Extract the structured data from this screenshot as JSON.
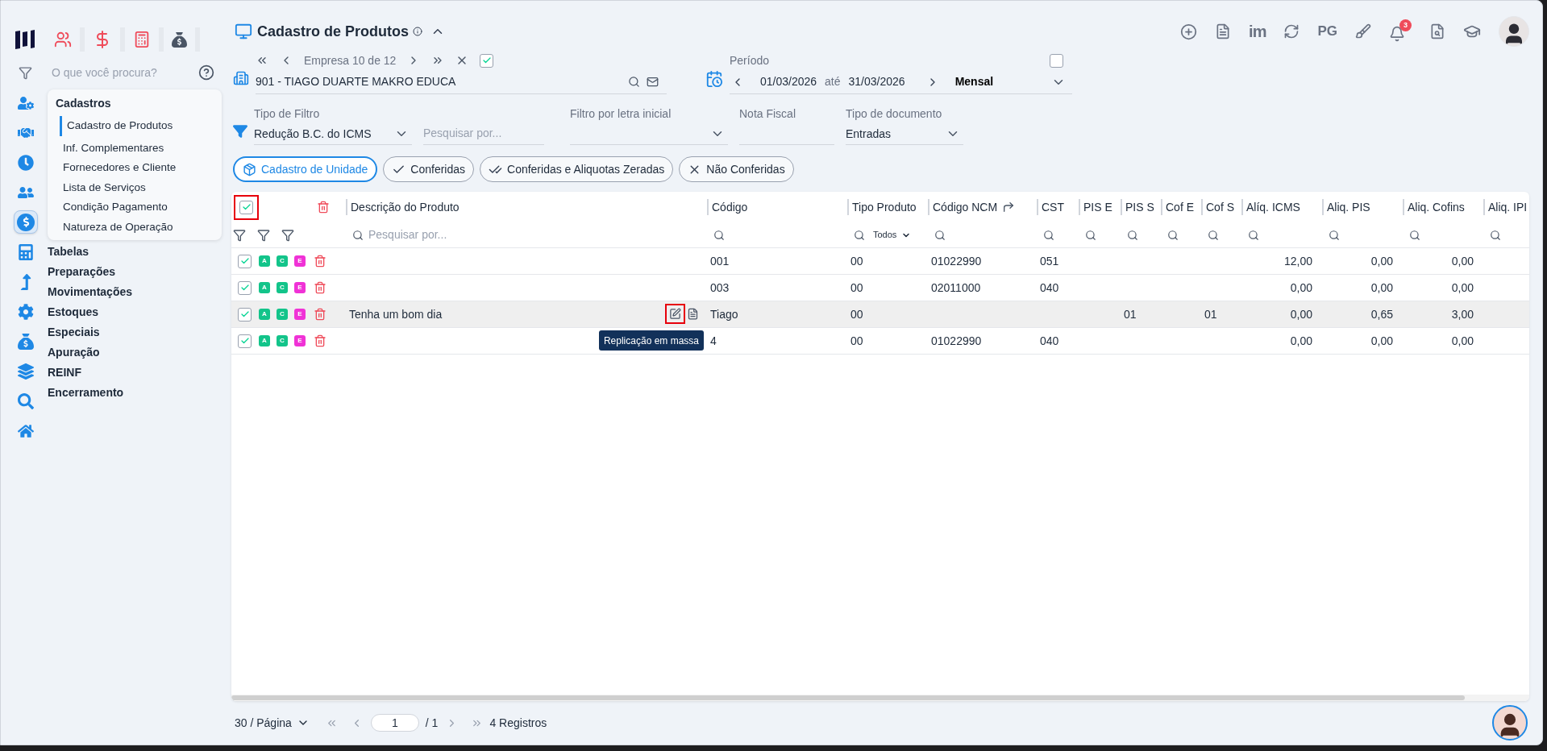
{
  "sidebar": {
    "search_placeholder": "O que você procura?",
    "nav_icons": [
      {
        "selected": false
      },
      {
        "selected": false
      },
      {
        "selected": false
      },
      {
        "selected": false
      },
      {
        "selected": true
      },
      {
        "selected": false
      },
      {
        "selected": false
      },
      {
        "selected": false
      },
      {
        "selected": false
      },
      {
        "selected": false
      },
      {
        "selected": false
      },
      {
        "selected": false
      }
    ],
    "menu": {
      "title": "Cadastros",
      "items": [
        {
          "label": "Cadastro de Produtos",
          "selected": true
        },
        {
          "label": "Inf. Complementares",
          "selected": false
        },
        {
          "label": "Fornecedores e Cliente",
          "selected": false
        },
        {
          "label": "Lista de Serviços",
          "selected": false
        },
        {
          "label": "Condição Pagamento",
          "selected": false
        },
        {
          "label": "Natureza de Operação",
          "selected": false
        }
      ]
    },
    "sections": [
      "Tabelas",
      "Preparações",
      "Movimentações",
      "Estoques",
      "Especiais",
      "Apuração",
      "REINF",
      "Encerramento"
    ]
  },
  "header": {
    "title": "Cadastro de Produtos",
    "toolbar": {
      "logo_text": "im",
      "pg_text": "PG",
      "notifications": "3"
    }
  },
  "company": {
    "nav_label": "Empresa 10 de 12",
    "checked": true,
    "name": "901 - TIAGO DUARTE MAKRO EDUCA"
  },
  "period": {
    "label": "Período",
    "start": "01/03/2026",
    "separator": "até",
    "end": "31/03/2026",
    "mode": "Mensal",
    "checked": false
  },
  "filters": [
    {
      "kind": "select",
      "label": "Tipo de Filtro",
      "value": "Redução B.C. do ICMS"
    },
    {
      "kind": "search",
      "placeholder": "Pesquisar por..."
    },
    {
      "kind": "select",
      "label": "Filtro por letra inicial"
    },
    {
      "kind": "text",
      "label": "Nota Fiscal"
    },
    {
      "kind": "select",
      "label": "Tipo de documento",
      "value": "Entradas"
    }
  ],
  "chips": [
    {
      "kind": "box",
      "label": "Cadastro de Unidade",
      "selected": true
    },
    {
      "kind": "check",
      "label": "Conferidas",
      "selected": false
    },
    {
      "kind": "double-check",
      "label": "Conferidas e Aliquotas Zeradas",
      "selected": false
    },
    {
      "kind": "x",
      "label": "Não Conferidas",
      "selected": false
    }
  ],
  "table": {
    "select_all": {
      "checked": true,
      "marked": true
    },
    "search_placeholder": "Pesquisar por...",
    "type_filter": "Todos",
    "columns": [
      {
        "label": "Descrição do Produto"
      },
      {
        "label": "Código"
      },
      {
        "label": "Tipo Produto"
      },
      {
        "label": "Código NCM",
        "kind": "redirect"
      },
      {
        "label": "CST"
      },
      {
        "label": "PIS E"
      },
      {
        "label": "PIS S"
      },
      {
        "label": "Cof E"
      },
      {
        "label": "Cof S"
      },
      {
        "label": "Alíq. ICMS"
      },
      {
        "label": "Aliq. PIS"
      },
      {
        "label": "Aliq. Cofins"
      },
      {
        "label": "Aliq. IPI"
      }
    ],
    "rows": [
      {
        "checked": true,
        "hovered": false,
        "tags": [
          {
            "label": "A",
            "color": "#13c48a"
          },
          {
            "label": "C",
            "color": "#13c48a"
          },
          {
            "label": "E",
            "color": "#f032d6"
          }
        ],
        "code": "001",
        "type": "00",
        "ncm": "01022990",
        "cst": "051",
        "aliq_icms": "12,00",
        "aliq_pis": "0,00",
        "aliq_cofins": "0,00"
      },
      {
        "checked": true,
        "hovered": false,
        "tags": [
          {
            "label": "A",
            "color": "#13c48a"
          },
          {
            "label": "C",
            "color": "#13c48a"
          },
          {
            "label": "E",
            "color": "#f032d6"
          }
        ],
        "code": "003",
        "type": "00",
        "ncm": "02011000",
        "cst": "040",
        "aliq_icms": "0,00",
        "aliq_pis": "0,00",
        "aliq_cofins": "0,00"
      },
      {
        "checked": true,
        "hovered": true,
        "edit_marked": true,
        "tooltip": "Replicação em massa",
        "tags": [
          {
            "label": "A",
            "color": "#13c48a"
          },
          {
            "label": "C",
            "color": "#13c48a"
          },
          {
            "label": "E",
            "color": "#f032d6"
          }
        ],
        "description": "Tenha um bom dia",
        "code": "Tiago",
        "type": "00",
        "pis_s": "01",
        "cof_s": "01",
        "aliq_icms": "0,00",
        "aliq_pis": "0,65",
        "aliq_cofins": "3,00"
      },
      {
        "checked": true,
        "hovered": false,
        "tags": [
          {
            "label": "A",
            "color": "#13c48a"
          },
          {
            "label": "C",
            "color": "#13c48a"
          },
          {
            "label": "E",
            "color": "#f032d6"
          }
        ],
        "code": "4",
        "type": "00",
        "ncm": "01022990",
        "cst": "040",
        "aliq_icms": "0,00",
        "aliq_pis": "0,00",
        "aliq_cofins": "0,00"
      }
    ]
  },
  "footer": {
    "page_size": "30 / Página",
    "page": "1",
    "total": "/ 1",
    "records": "4 Registros"
  }
}
